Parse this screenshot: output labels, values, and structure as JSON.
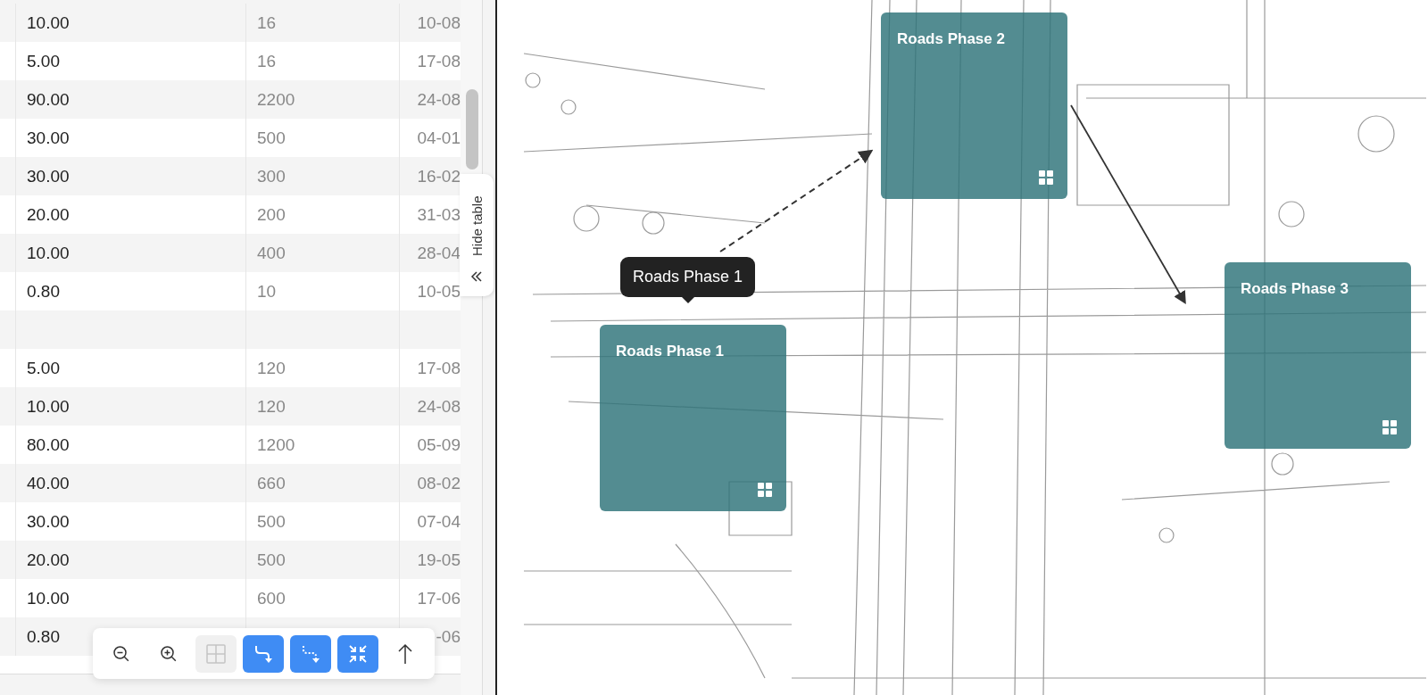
{
  "table": {
    "rows": [
      {
        "kind": "data",
        "column_1": "10.00",
        "column_2": "16",
        "column_3": "10-08"
      },
      {
        "kind": "data",
        "column_1": "5.00",
        "column_2": "16",
        "column_3": "17-08"
      },
      {
        "kind": "data",
        "column_1": "90.00",
        "column_2": "2200",
        "column_3": "24-08"
      },
      {
        "kind": "data",
        "column_1": "30.00",
        "column_2": "500",
        "column_3": "04-01"
      },
      {
        "kind": "data",
        "column_1": "30.00",
        "column_2": "300",
        "column_3": "16-02"
      },
      {
        "kind": "data",
        "column_1": "20.00",
        "column_2": "200",
        "column_3": "31-03"
      },
      {
        "kind": "data",
        "column_1": "10.00",
        "column_2": "400",
        "column_3": "28-04"
      },
      {
        "kind": "data",
        "column_1": "0.80",
        "column_2": "10",
        "column_3": "10-05"
      },
      {
        "kind": "blank"
      },
      {
        "kind": "data",
        "column_1": "5.00",
        "column_2": "120",
        "column_3": "17-08"
      },
      {
        "kind": "data",
        "column_1": "10.00",
        "column_2": "120",
        "column_3": "24-08"
      },
      {
        "kind": "data",
        "column_1": "80.00",
        "column_2": "1200",
        "column_3": "05-09"
      },
      {
        "kind": "data",
        "column_1": "40.00",
        "column_2": "660",
        "column_3": "08-02"
      },
      {
        "kind": "data",
        "column_1": "30.00",
        "column_2": "500",
        "column_3": "07-04"
      },
      {
        "kind": "data",
        "column_1": "20.00",
        "column_2": "500",
        "column_3": "19-05"
      },
      {
        "kind": "data",
        "column_1": "10.00",
        "column_2": "600",
        "column_3": "17-06"
      },
      {
        "kind": "data",
        "column_1": "0.80",
        "column_3": "-06"
      }
    ]
  },
  "hide_table": {
    "label": "Hide table"
  },
  "canvas": {
    "tooltip": {
      "text": "Roads Phase 1"
    },
    "cards": [
      {
        "title": "Roads Phase 1"
      },
      {
        "title": "Roads Phase 2"
      },
      {
        "title": "Roads Phase 3"
      }
    ]
  },
  "toolbar": {
    "buttons": [
      {
        "kind": "zoom-out",
        "on": false,
        "disabled": false
      },
      {
        "kind": "zoom-in",
        "on": false,
        "disabled": false
      },
      {
        "kind": "grid",
        "on": false,
        "disabled": true
      },
      {
        "kind": "route",
        "on": true,
        "disabled": false
      },
      {
        "kind": "dotted-route",
        "on": true,
        "disabled": false
      },
      {
        "kind": "collapse",
        "on": true,
        "disabled": false
      },
      {
        "kind": "up",
        "on": false,
        "disabled": false
      }
    ]
  }
}
